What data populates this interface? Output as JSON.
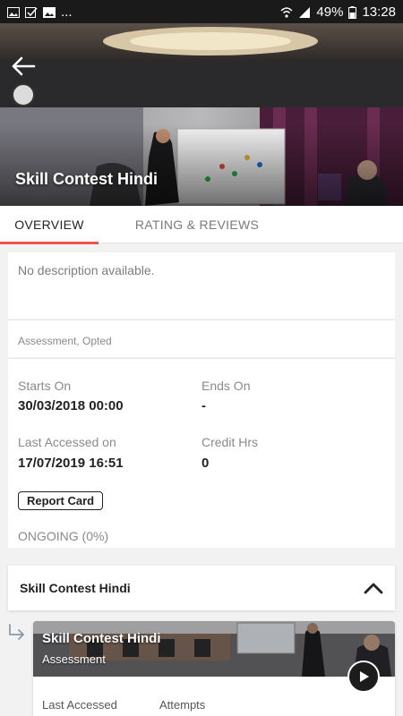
{
  "status_bar": {
    "battery": "49%",
    "time": "13:28",
    "overflow": "..."
  },
  "hero": {
    "title": "Skill Contest Hindi"
  },
  "tabs": [
    {
      "label": "OVERVIEW"
    },
    {
      "label": "RATING & REVIEWS"
    }
  ],
  "overview": {
    "description": "No description available.",
    "meta": "Assessment, Opted",
    "starts_on_label": "Starts On",
    "starts_on_value": "30/03/2018 00:00",
    "ends_on_label": "Ends On",
    "ends_on_value": "-",
    "last_accessed_label": "Last Accessed on",
    "last_accessed_value": "17/07/2019 16:51",
    "credit_label": "Credit Hrs",
    "credit_value": "0",
    "report_card_label": "Report Card",
    "status": "ONGOING (0%)"
  },
  "module": {
    "title": "Skill Contest Hindi",
    "expanded": true
  },
  "sub_item": {
    "title": "Skill Contest Hindi",
    "type": "Assessment",
    "last_accessed_label": "Last Accessed",
    "attempts_label": "Attempts"
  },
  "colors": {
    "accent": "#ef5350",
    "status_bar": "#1a1a1a",
    "background": "#f2f2f2"
  }
}
